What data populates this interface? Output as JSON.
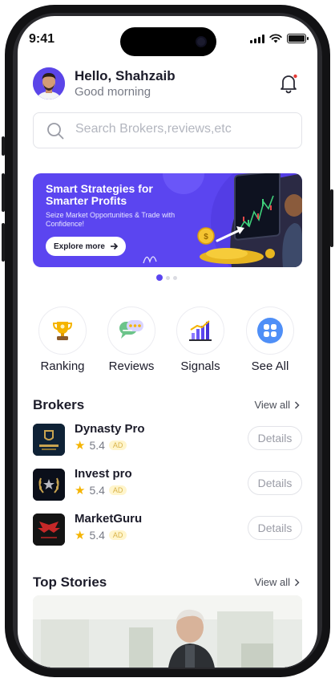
{
  "status_bar": {
    "time": "9:41"
  },
  "header": {
    "greeting": "Hello, Shahzaib",
    "subtitle": "Good morning"
  },
  "search": {
    "placeholder": "Search Brokers,reviews,etc"
  },
  "banner": {
    "title": "Smart Strategies for Smarter Profits",
    "subtitle": "Seize Market Opportunities & Trade with Confidence!",
    "button_label": "Explore more",
    "accent_color": "#5b45f0",
    "carousel_total": 3,
    "carousel_active": 1
  },
  "quick_actions": [
    {
      "label": "Ranking",
      "icon": "trophy-icon"
    },
    {
      "label": "Reviews",
      "icon": "reviews-chat-icon"
    },
    {
      "label": "Signals",
      "icon": "signals-chart-icon"
    },
    {
      "label": "See All",
      "icon": "apps-grid-icon"
    }
  ],
  "brokers": {
    "title": "Brokers",
    "view_all": "View all",
    "items": [
      {
        "name": "Dynasty Pro",
        "rating": "5.4",
        "badge": "AD",
        "action": "Details",
        "logo_icon": "dynasty-logo-icon"
      },
      {
        "name": "Invest pro",
        "rating": "5.4",
        "badge": "AD",
        "action": "Details",
        "logo_icon": "invest-laurel-logo-icon"
      },
      {
        "name": "MarketGuru",
        "rating": "5.4",
        "badge": "AD",
        "action": "Details",
        "logo_icon": "elite-wings-logo-icon"
      }
    ]
  },
  "top_stories": {
    "title": "Top Stories",
    "view_all": "View all"
  }
}
